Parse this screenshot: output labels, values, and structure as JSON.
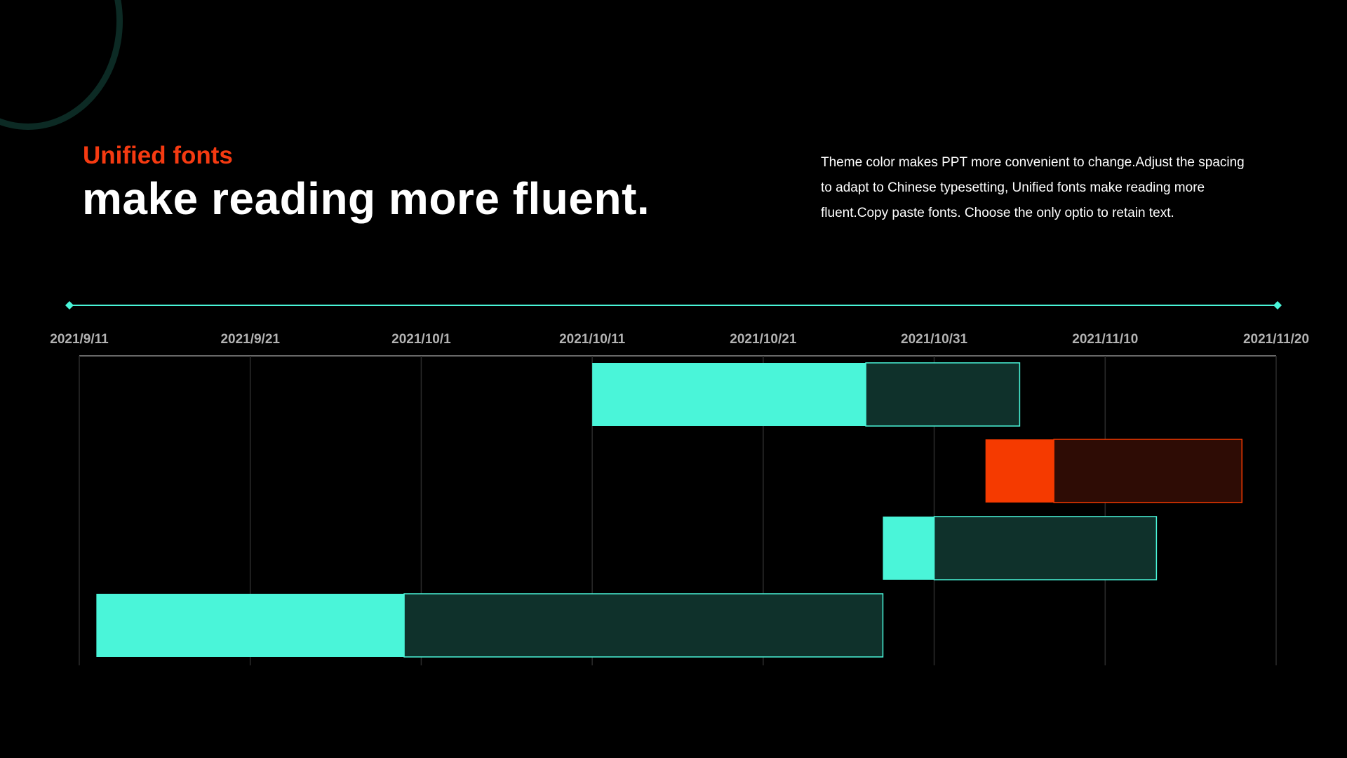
{
  "header": {
    "subtitle": "Unified fonts",
    "title": "make reading more fluent.",
    "description": "Theme color makes PPT more convenient to change.Adjust the spacing to adapt to Chinese typesetting, Unified fonts make reading more fluent.Copy paste fonts. Choose the only optio to retain text."
  },
  "colors": {
    "accent": "#4af5d9",
    "accent_dark": "#0f312b",
    "highlight": "#f53a00",
    "highlight_dark": "#2e0c05",
    "grid": "#2b2b2b",
    "tick_text": "#b3b3b3"
  },
  "chart_data": {
    "type": "bar",
    "orientation": "horizontal",
    "stacked": true,
    "x_axis": {
      "type": "date",
      "min": "2021-09-11",
      "max": "2021-11-20",
      "tick_labels": [
        "2021/9/11",
        "2021/9/21",
        "2021/10/1",
        "2021/10/11",
        "2021/10/21",
        "2021/10/31",
        "2021/11/10",
        "2021/11/20"
      ],
      "position": "top"
    },
    "grid": true,
    "legend": "none",
    "tasks": [
      {
        "start": "2021-10-11",
        "split": "2021-10-27",
        "end": "2021-11-05",
        "highlight": false
      },
      {
        "start": "2021-11-03",
        "split": "2021-11-07",
        "end": "2021-11-18",
        "highlight": true
      },
      {
        "start": "2021-10-28",
        "split": "2021-10-31",
        "end": "2021-11-13",
        "highlight": false
      },
      {
        "start": "2021-09-12",
        "split": "2021-09-30",
        "end": "2021-10-28",
        "highlight": false
      }
    ]
  }
}
